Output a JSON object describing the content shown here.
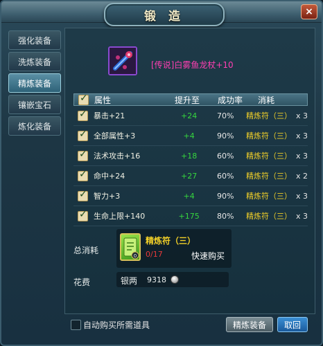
{
  "window": {
    "title": "锻 造",
    "close_label": "×"
  },
  "nav": {
    "items": [
      {
        "label": "强化装备"
      },
      {
        "label": "洗炼装备"
      },
      {
        "label": "精炼装备"
      },
      {
        "label": "镶嵌宝石"
      },
      {
        "label": "炼化装备"
      }
    ],
    "active_index": 2
  },
  "item": {
    "name": "[传说]白雾鱼龙杖+10",
    "rarity_color": "#ff3fb2"
  },
  "table": {
    "headers": {
      "attribute": "属性",
      "upgrade_to": "提升至",
      "success_rate": "成功率",
      "cost": "消耗"
    },
    "rows": [
      {
        "attribute": "暴击+21",
        "upgrade_to": "+24",
        "rate": "70%",
        "cost_item": "精炼符（三）",
        "qty": "x 3"
      },
      {
        "attribute": "全部属性+3",
        "upgrade_to": "+4",
        "rate": "90%",
        "cost_item": "精炼符（三）",
        "qty": "x 3"
      },
      {
        "attribute": "法术攻击+16",
        "upgrade_to": "+18",
        "rate": "60%",
        "cost_item": "精炼符（三）",
        "qty": "x 3"
      },
      {
        "attribute": "命中+24",
        "upgrade_to": "+27",
        "rate": "60%",
        "cost_item": "精炼符（三）",
        "qty": "x 2"
      },
      {
        "attribute": "智力+3",
        "upgrade_to": "+4",
        "rate": "90%",
        "cost_item": "精炼符（三）",
        "qty": "x 3"
      },
      {
        "attribute": "生命上限+140",
        "upgrade_to": "+175",
        "rate": "80%",
        "cost_item": "精炼符（三）",
        "qty": "x 3"
      }
    ]
  },
  "cost": {
    "label": "总消耗",
    "item_name": "精炼符（三）",
    "count": "0/17",
    "quick_buy": "快速购买",
    "slot_count": "0"
  },
  "fee": {
    "label": "花费",
    "currency": "银两",
    "amount": "9318"
  },
  "footer": {
    "auto_buy_label": "自动购买所需道具",
    "refine_button": "精炼装备",
    "cancel_button": "取回"
  }
}
